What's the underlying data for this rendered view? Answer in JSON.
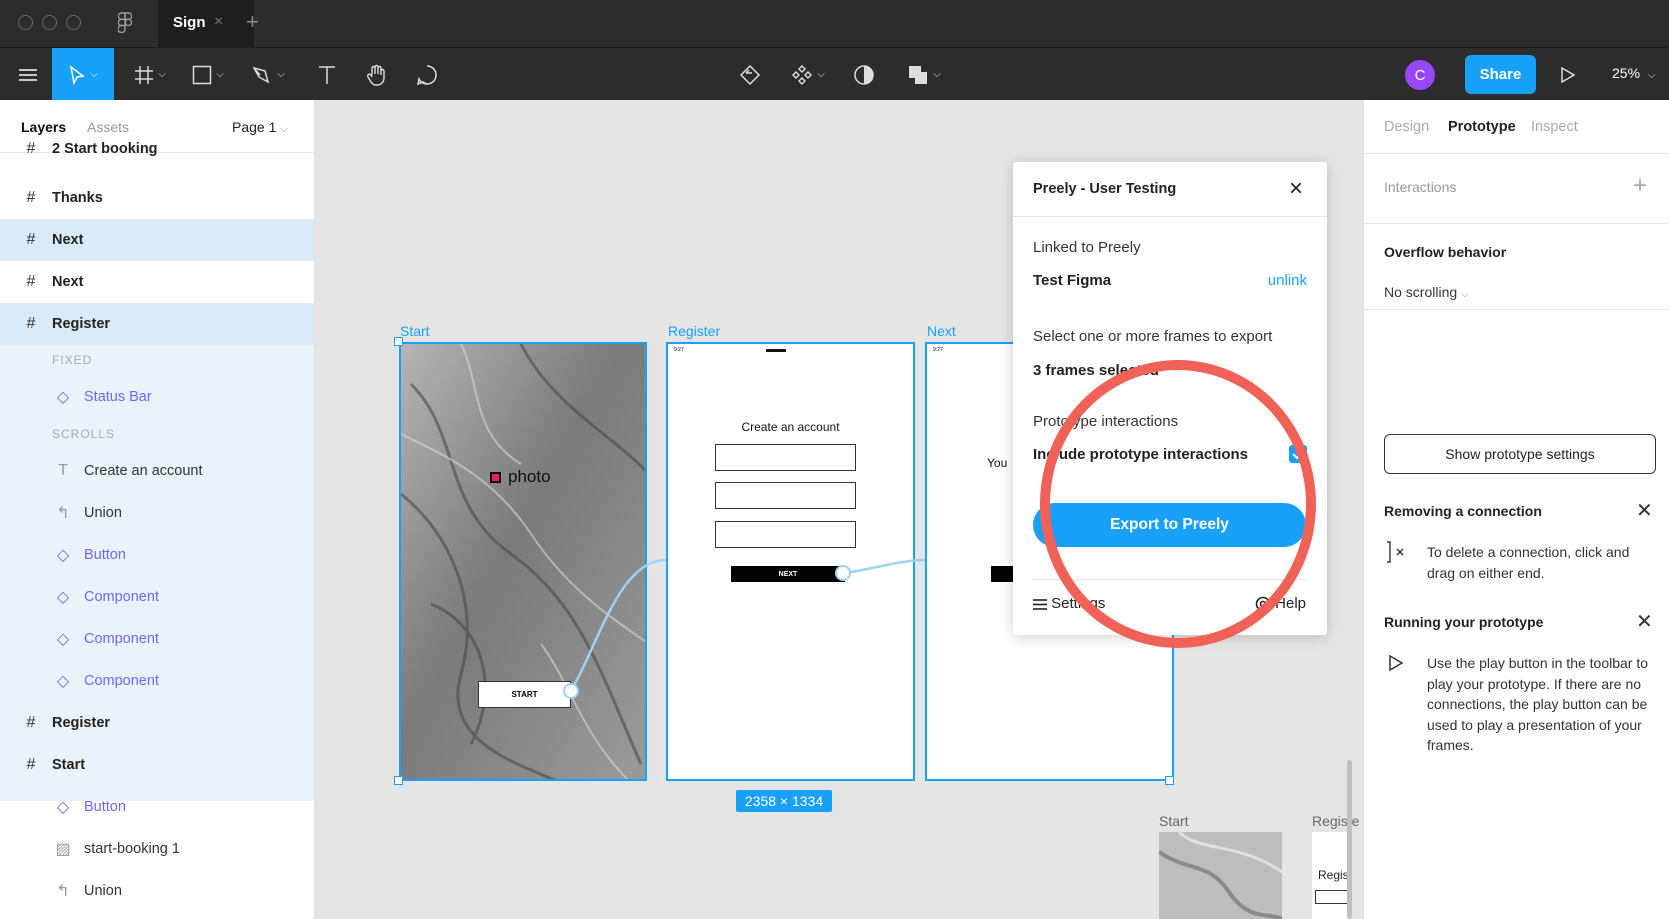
{
  "titlebar": {
    "tab_label": "Sign",
    "tab_close": "×",
    "new_tab": "+"
  },
  "toolbar": {
    "avatar_initial": "C",
    "share_label": "Share",
    "zoom_level": "25%"
  },
  "left_panel": {
    "tabs": {
      "layers": "Layers",
      "assets": "Assets"
    },
    "page_label": "Page 1",
    "layers": [
      {
        "label": "2 Start booking",
        "kind": "frame"
      },
      {
        "label": "Thanks",
        "kind": "frame"
      },
      {
        "label": "Next",
        "kind": "frame",
        "selected": true
      },
      {
        "label": "Next",
        "kind": "frame"
      },
      {
        "label": "Register",
        "kind": "frame",
        "selected": true
      },
      {
        "label": "FIXED",
        "kind": "section"
      },
      {
        "label": "Status Bar",
        "kind": "component"
      },
      {
        "label": "SCROLLS",
        "kind": "section"
      },
      {
        "label": "Create an account",
        "kind": "text"
      },
      {
        "label": "Union",
        "kind": "union"
      },
      {
        "label": "Button",
        "kind": "component"
      },
      {
        "label": "Component",
        "kind": "component"
      },
      {
        "label": "Component",
        "kind": "component"
      },
      {
        "label": "Component",
        "kind": "component"
      },
      {
        "label": "Register",
        "kind": "frame"
      },
      {
        "label": "Start",
        "kind": "frame"
      },
      {
        "label": "Button",
        "kind": "component"
      },
      {
        "label": "start-booking 1",
        "kind": "image"
      },
      {
        "label": "Union",
        "kind": "union"
      }
    ]
  },
  "right_panel": {
    "tabs": [
      "Design",
      "Prototype",
      "Inspect"
    ],
    "active_tab": "Prototype",
    "interactions_label": "Interactions",
    "add_icon": "+",
    "overflow_title": "Overflow behavior",
    "overflow_value": "No scrolling",
    "show_settings_button": "Show prototype settings",
    "removing_title": "Removing a connection",
    "removing_text": "To delete a connection, click and drag on either end.",
    "running_title": "Running your prototype",
    "running_text": "Use the play button in the toolbar to play your prototype. If there are no connections, the play button can be used to play a presentation of your frames."
  },
  "canvas": {
    "frame_labels": {
      "start": "Start",
      "register": "Register",
      "next": "Next"
    },
    "logo_text": "photo",
    "start_button": "START",
    "create_account": "Create an account",
    "next_button": "NEXT",
    "next_partial_text": "You",
    "status_time": "9:27",
    "dimensions": "2358 × 1334",
    "thumb_labels": {
      "start": "Start",
      "register": "Registe"
    },
    "thumb_register_text": "Registe"
  },
  "modal": {
    "title": "Preely - User Testing",
    "linked_label": "Linked to Preely",
    "project_name": "Test Figma",
    "unlink_label": "unlink",
    "select_label": "Select one or more frames to export",
    "frames_selected": "3 frames selected",
    "interactions_label": "Prototype interactions",
    "include_label": "Include prototype interactions",
    "include_checked": true,
    "export_button": "Export to Preely",
    "settings_label": "Settings",
    "help_label": "Help"
  },
  "colors": {
    "accent": "#18a0fb",
    "avatar": "#9747ff",
    "component": "#7b61ff",
    "highlight_circle": "#f06158"
  }
}
